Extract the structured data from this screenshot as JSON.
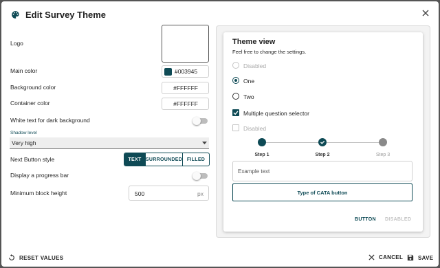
{
  "dialog": {
    "title": "Edit Survey Theme",
    "close_icon": "close-icon",
    "title_icon": "palette-icon"
  },
  "form": {
    "logo_label": "Logo",
    "main_color_label": "Main color",
    "main_color_value": "#003945",
    "main_color_swatch": "#0e4a55",
    "background_color_label": "Background color",
    "background_color_value": "#FFFFFF",
    "container_color_label": "Container color",
    "container_color_value": "#FFFFFF",
    "white_text_label": "White text for dark background",
    "white_text_on": false,
    "shadow_label": "Shadow level",
    "shadow_value": "Very high",
    "next_button_label": "Next Button style",
    "next_button_options": [
      "TEXT",
      "SURROUNDED",
      "FILLED"
    ],
    "next_button_selected": "TEXT",
    "progress_bar_label": "Display a progress bar",
    "progress_bar_on": false,
    "min_block_label": "Minimum block height",
    "min_block_value": "500",
    "min_block_unit": "px"
  },
  "preview": {
    "title": "Theme view",
    "subtitle": "Feel free to change the settings.",
    "radio_disabled": "Disabled",
    "radio_one": "One",
    "radio_two": "Two",
    "checkbox_multi": "Multiple question selector",
    "checkbox_disabled": "Disabled",
    "steps": [
      "Step 1",
      "Step 2",
      "Step 3"
    ],
    "text_placeholder": "Example text",
    "cata_button": "Type of CATA button",
    "button_label": "BUTTON",
    "disabled_button_label": "DISABLED"
  },
  "footer": {
    "reset": "RESET VALUES",
    "cancel": "CANCEL",
    "save": "SAVE"
  },
  "colors": {
    "accent": "#0e4a55",
    "step_inactive": "#8a8a8a"
  }
}
